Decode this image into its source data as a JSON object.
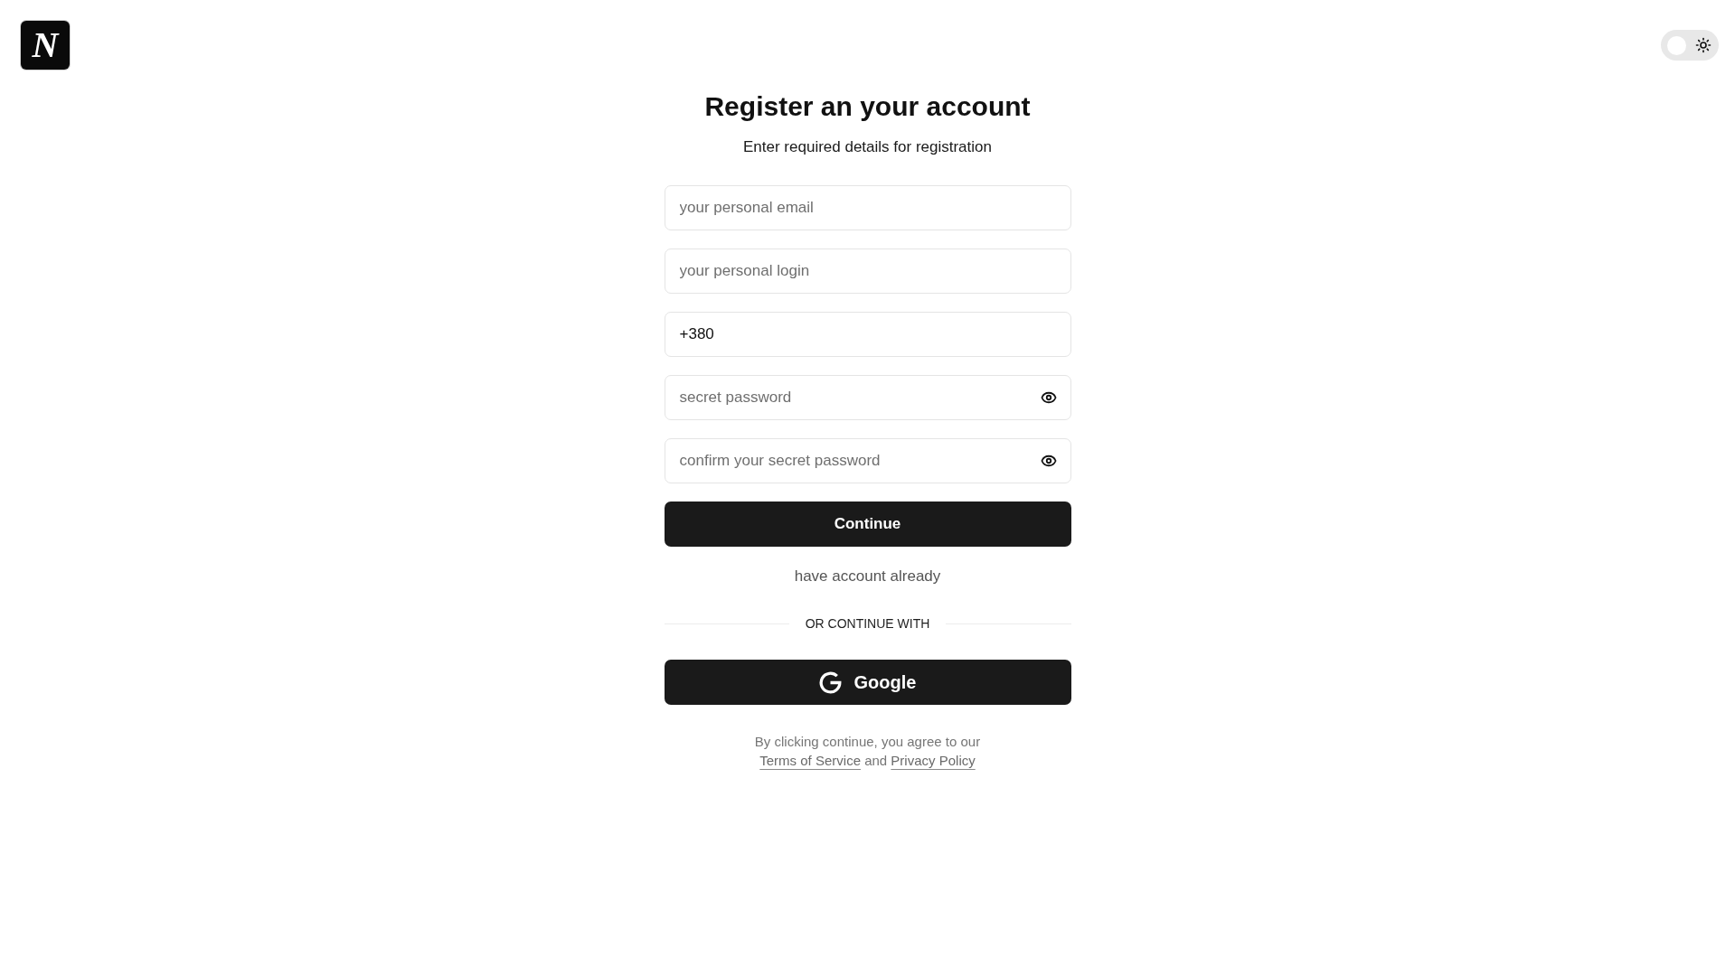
{
  "logo": {
    "letter": "N"
  },
  "theme_toggle": {
    "on": false
  },
  "form": {
    "title": "Register an your account",
    "subtitle": "Enter required details for registration",
    "fields": [
      {
        "kind": "text",
        "placeholder": "your personal email"
      },
      {
        "kind": "text",
        "placeholder": "your personal login"
      },
      {
        "kind": "text",
        "value": "+380"
      },
      {
        "kind": "password",
        "placeholder": "secret password"
      },
      {
        "kind": "password",
        "placeholder": "confirm your secret password"
      }
    ],
    "submit_button": "Continue",
    "login_link": "have account already",
    "divider_label": "OR CONTINUE WITH",
    "google_button": "Google",
    "legal": {
      "text": "By clicking continue, you agree to our",
      "terms_link": "Terms of Service",
      "joiner": "and",
      "privacy_link": "Privacy Policy"
    }
  }
}
